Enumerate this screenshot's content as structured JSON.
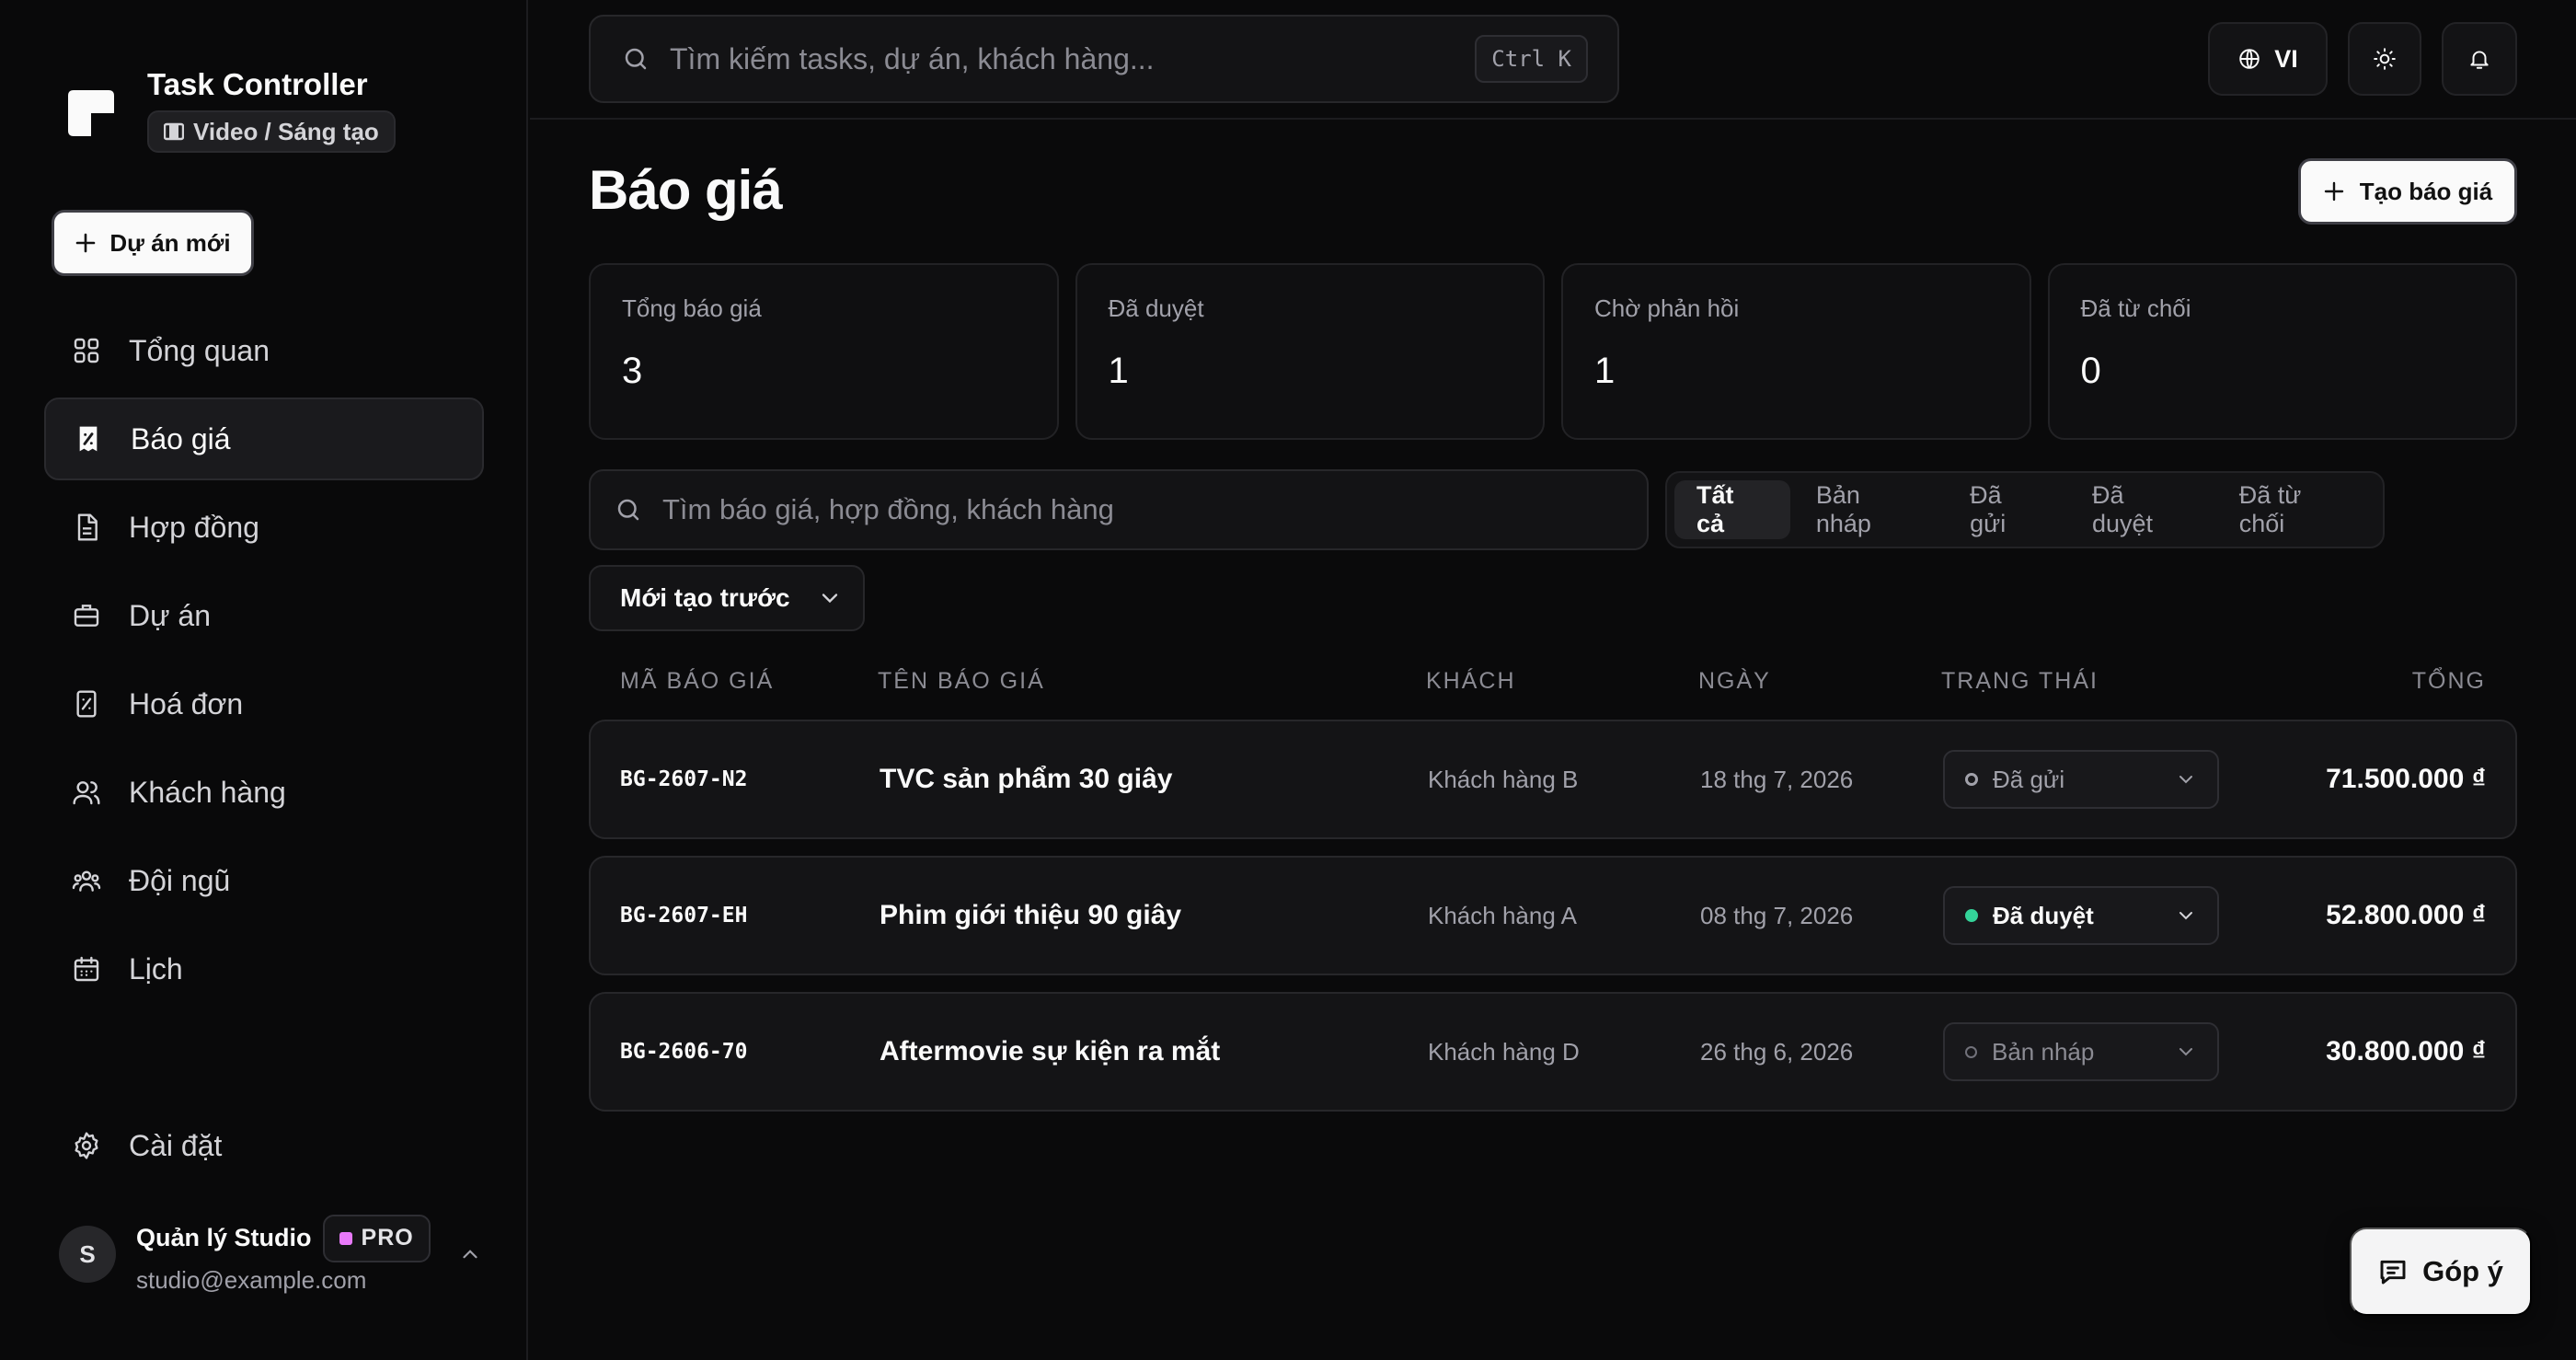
{
  "brand": {
    "title": "Task Controller",
    "tag": "Video / Sáng tạo"
  },
  "sidebar": {
    "new_project_label": "Dự án mới",
    "items": [
      {
        "label": "Tổng quan",
        "icon": "grid-icon"
      },
      {
        "label": "Báo giá",
        "icon": "quote-receipt-icon"
      },
      {
        "label": "Hợp đồng",
        "icon": "document-icon"
      },
      {
        "label": "Dự án",
        "icon": "briefcase-icon"
      },
      {
        "label": "Hoá đơn",
        "icon": "invoice-icon"
      },
      {
        "label": "Khách hàng",
        "icon": "users-icon"
      },
      {
        "label": "Đội ngũ",
        "icon": "team-icon"
      },
      {
        "label": "Lịch",
        "icon": "calendar-icon"
      }
    ],
    "settings_label": "Cài đặt",
    "user": {
      "initial": "S",
      "name": "Quản lý Studio",
      "plan": "PRO",
      "email": "studio@example.com"
    }
  },
  "topbar": {
    "search_placeholder": "Tìm kiếm tasks, dự án, khách hàng...",
    "shortcut": "Ctrl K",
    "language": "VI"
  },
  "main": {
    "title": "Báo giá",
    "create_label": "Tạo báo giá",
    "stats": [
      {
        "label": "Tổng báo giá",
        "value": "3"
      },
      {
        "label": "Đã duyệt",
        "value": "1"
      },
      {
        "label": "Chờ phản hồi",
        "value": "1"
      },
      {
        "label": "Đã từ chối",
        "value": "0"
      }
    ],
    "filter_placeholder": "Tìm báo giá, hợp đồng, khách hàng",
    "tabs": [
      "Tất cả",
      "Bản nháp",
      "Đã gửi",
      "Đã duyệt",
      "Đã từ chối"
    ],
    "active_tab": "Tất cả",
    "sort_label": "Mới tạo trước",
    "columns": [
      "MÃ BÁO GIÁ",
      "TÊN BÁO GIÁ",
      "KHÁCH",
      "NGÀY",
      "TRẠNG THÁI",
      "TỔNG"
    ],
    "rows": [
      {
        "code": "BG-2607-N2",
        "name": "TVC sản phẩm 30 giây",
        "client": "Khách hàng B",
        "date": "18 thg 7, 2026",
        "status": "Đã gửi",
        "total": "71.500.000 ₫"
      },
      {
        "code": "BG-2607-EH",
        "name": "Phim giới thiệu 90 giây",
        "client": "Khách hàng A",
        "date": "08 thg 7, 2026",
        "status": "Đã duyệt",
        "total": "52.800.000 ₫"
      },
      {
        "code": "BG-2606-70",
        "name": "Aftermovie sự kiện ra mắt",
        "client": "Khách hàng D",
        "date": "26 thg 6, 2026",
        "status": "Bản nháp",
        "total": "30.800.000 ₫"
      }
    ]
  },
  "feedback_label": "Góp ý",
  "colors": {
    "background": "#0a0a0b",
    "approved_dot": "#34d399",
    "pro_dot": "#e879f9"
  }
}
